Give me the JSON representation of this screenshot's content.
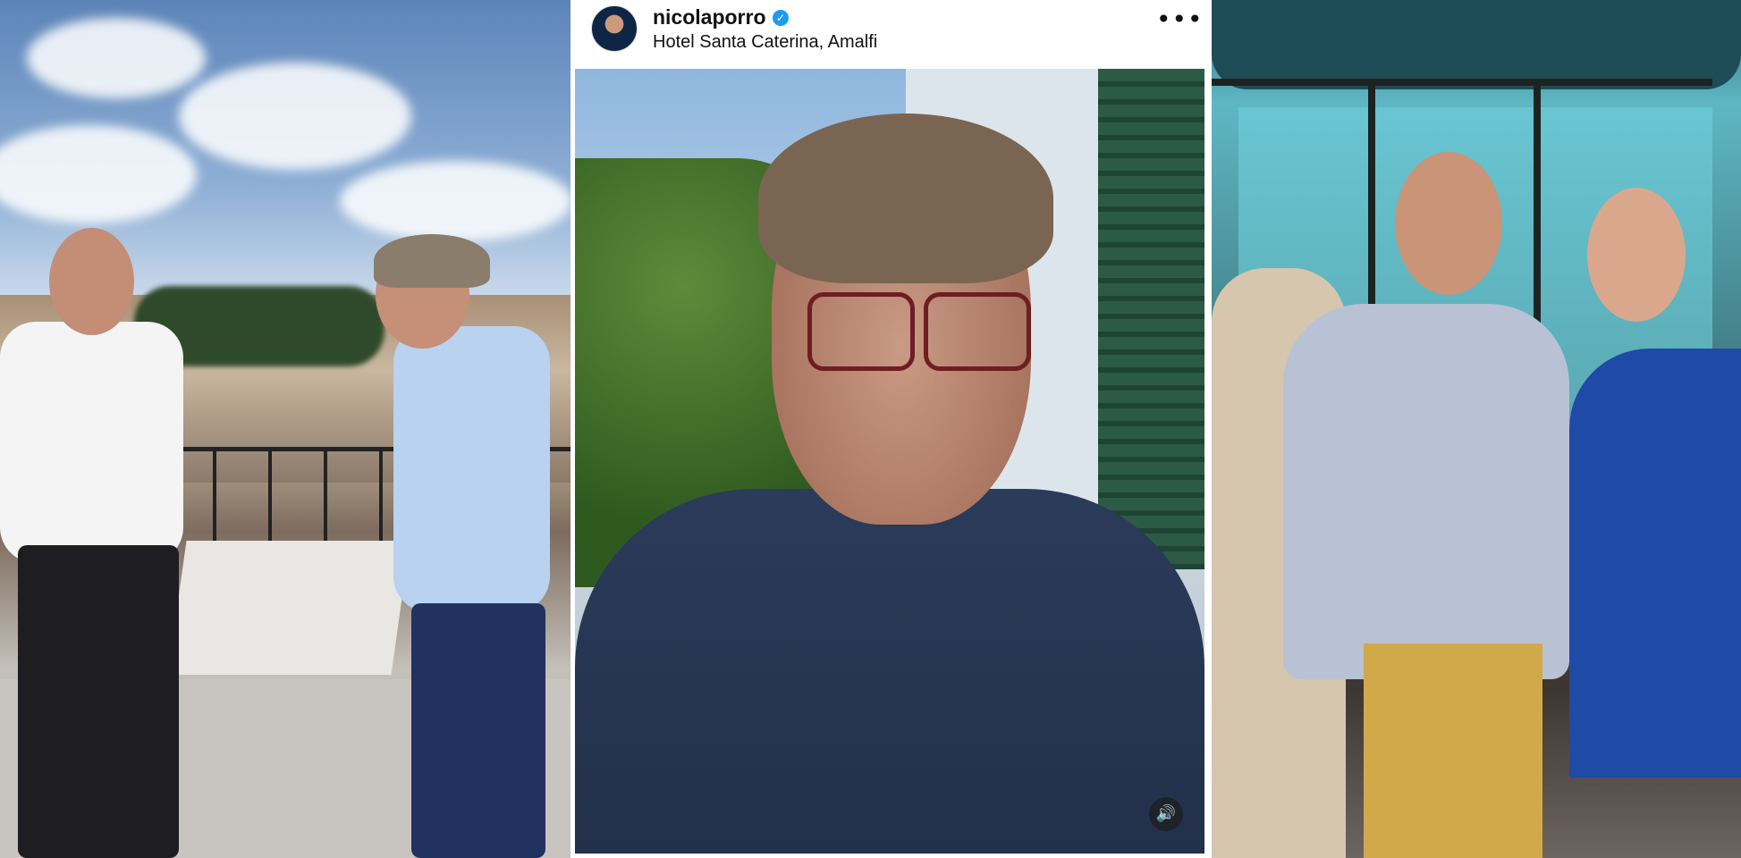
{
  "post": {
    "username": "nicolaporro",
    "verified_mark": "✓",
    "location": "Hotel Santa Caterina, Amalfi",
    "more_label": "•••",
    "sound_icon": "🔊"
  },
  "icons": {
    "verified": "verified-badge-icon",
    "more": "more-options-icon",
    "sound": "speaker-icon"
  },
  "colors": {
    "verified_badge": "#1d9bf0",
    "text": "#111111",
    "background": "#ffffff"
  }
}
